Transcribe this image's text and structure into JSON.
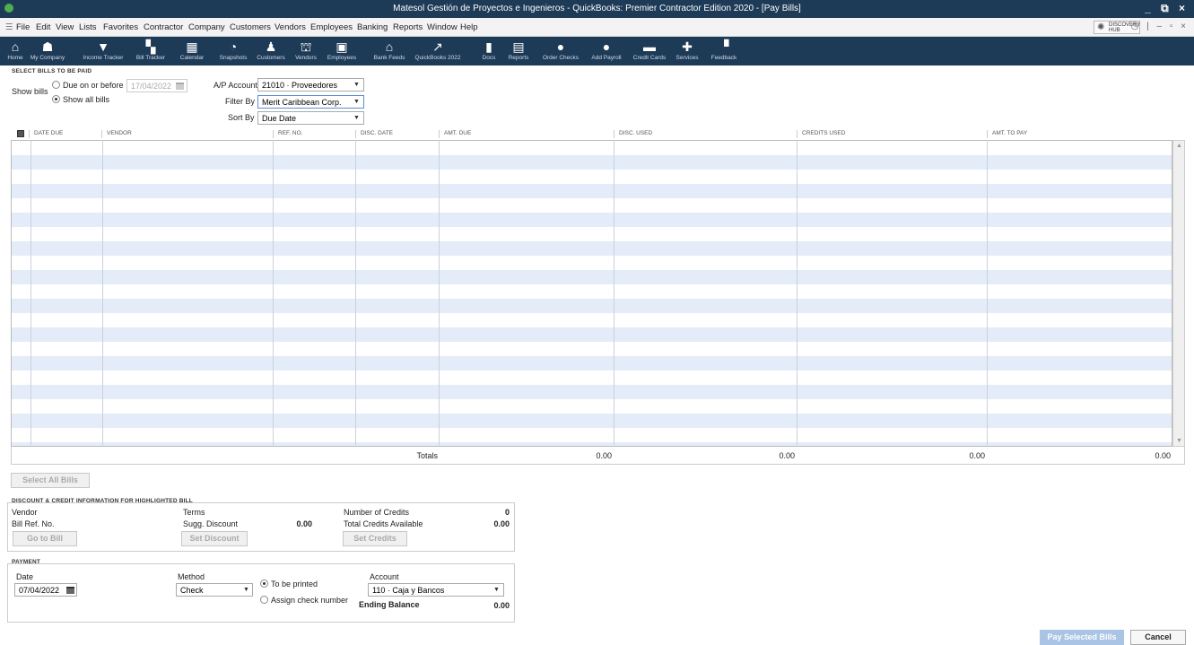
{
  "window": {
    "title": "Matesol Gestión de Proyectos e Ingenieros  - QuickBooks: Premier Contractor Edition 2020 - [Pay Bills]",
    "controls": "_ ⧉ ×"
  },
  "menu": {
    "items": [
      "File",
      "Edit",
      "View",
      "Lists",
      "Favorites",
      "Contractor",
      "Company",
      "Customers",
      "Vendors",
      "Employees",
      "Banking",
      "Reports",
      "Window",
      "Help"
    ],
    "hub_line1": "DISCOVERY",
    "hub_line2": "HUB",
    "right_controls": "◷ | – ▫ ×"
  },
  "toolbar": {
    "items": [
      {
        "label": "Home",
        "icon": "⌂"
      },
      {
        "label": "My Company",
        "icon": "☗"
      },
      {
        "label": "Income Tracker",
        "icon": "▼"
      },
      {
        "label": "Bill Tracker",
        "icon": "▚"
      },
      {
        "label": "Calendar",
        "icon": "▦"
      },
      {
        "label": "Snapshots",
        "icon": "◔"
      },
      {
        "label": "Customers",
        "icon": "♟"
      },
      {
        "label": "Vendors",
        "icon": "⛫"
      },
      {
        "label": "Employees",
        "icon": "▣"
      },
      {
        "label": "Bank Feeds",
        "icon": "⌂"
      },
      {
        "label": "QuickBooks 2022",
        "icon": "↗"
      },
      {
        "label": "Docs",
        "icon": "▮"
      },
      {
        "label": "Reports",
        "icon": "▤"
      },
      {
        "label": "Order Checks",
        "icon": "●"
      },
      {
        "label": "Add Payroll",
        "icon": "●"
      },
      {
        "label": "Credit Cards",
        "icon": "▬"
      },
      {
        "label": "Services",
        "icon": "✚"
      },
      {
        "label": "Feedback",
        "icon": "▝"
      }
    ]
  },
  "select": {
    "section_title": "SELECT BILLS TO BE PAID",
    "show_bills_label": "Show bills",
    "due_on_before_label": "Due on or before",
    "due_date_value": "17/04/2022",
    "show_all_label": "Show all bills",
    "ap_account_label": "A/P Account",
    "ap_account_value": "21010 · Proveedores",
    "filter_by_label": "Filter By",
    "filter_by_value": "Merit Caribbean Corp.",
    "sort_by_label": "Sort By",
    "sort_by_value": "Due Date"
  },
  "grid": {
    "columns": [
      "DATE DUE",
      "VENDOR",
      "REF. NO.",
      "DISC. DATE",
      "AMT. DUE",
      "DISC. USED",
      "CREDITS USED",
      "AMT. TO PAY"
    ],
    "totals_label": "Totals",
    "totals": [
      "0.00",
      "0.00",
      "0.00",
      "0.00"
    ]
  },
  "select_all_label": "Select All Bills",
  "discount": {
    "section_title": "DISCOUNT & CREDIT INFORMATION FOR HIGHLIGHTED BILL",
    "vendor_label": "Vendor",
    "bill_ref_label": "Bill Ref. No.",
    "terms_label": "Terms",
    "sugg_discount_label": "Sugg. Discount",
    "sugg_discount_value": "0.00",
    "num_credits_label": "Number of Credits",
    "num_credits_value": "0",
    "total_credits_label": "Total Credits Available",
    "total_credits_value": "0.00",
    "go_to_bill": "Go to Bill",
    "set_discount": "Set Discount",
    "set_credits": "Set Credits"
  },
  "payment": {
    "section_title": "PAYMENT",
    "date_label": "Date",
    "date_value": "07/04/2022",
    "method_label": "Method",
    "method_value": "Check",
    "to_be_printed": "To be printed",
    "assign_check": "Assign check number",
    "account_label": "Account",
    "account_value": "110 · Caja y Bancos",
    "ending_balance_label": "Ending Balance",
    "ending_balance_value": "0.00"
  },
  "footer": {
    "pay_selected": "Pay Selected Bills",
    "cancel": "Cancel"
  }
}
